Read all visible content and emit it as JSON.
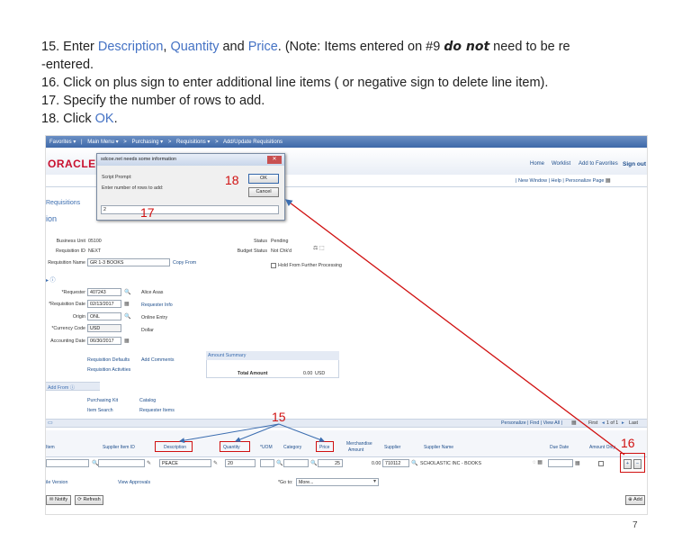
{
  "instructions": {
    "l15_a": "15.   Enter ",
    "l15_desc": "Description",
    "l15_b": ", ",
    "l15_qty": "Quantity",
    "l15_c": " and ",
    "l15_price": "Price",
    "l15_d": ". (Note:  Items entered  on #9 ",
    "l15_em": "do not",
    "l15_e": " need to be re",
    "l15_f": "-entered.",
    "l16": "16.   Click on plus sign to enter additional line items ( or negative sign to delete line item).",
    "l17": "17.  Specify the number of rows to add.",
    "l18_a": "18.   Click ",
    "l18_ok": "OK",
    "l18_b": "."
  },
  "nav": {
    "items": [
      "Favorites ▾",
      "|",
      "Main Menu ▾",
      ">",
      "Purchasing ▾",
      ">",
      "Requisitions ▾",
      ">",
      "Add/Update Requisitions"
    ]
  },
  "header": {
    "logo": "ORACLE",
    "home": "Home",
    "worklist": "Worklist",
    "add_fav": "Add to Favorites",
    "signout": "Sign out",
    "sublinks": "| New Window | Help | Personalize Page |"
  },
  "page": {
    "crumb": "Requisitions",
    "title": "ion"
  },
  "dialog": {
    "title": "sdcoe.net needs some information",
    "close": "✕",
    "prompt_a": "Script Prompt:",
    "prompt_b": "Enter number of rows to add:",
    "value": "2",
    "ok": "OK",
    "cancel": "Cancel"
  },
  "form": {
    "bu_label": "Business Unit",
    "bu_value": "05100",
    "reqid_label": "Requisition ID",
    "reqid_value": "NEXT",
    "reqname_label": "Requisition Name",
    "reqname_value": "GR 1-3 BOOKS",
    "copy_from": "Copy From",
    "status_label": "Status",
    "status_value": "Pending",
    "budget_label": "Budget Status",
    "budget_value": "Not Chk'd",
    "hold": "Hold From Further Processing",
    "requester_label": "*Requester",
    "requester_value": "407243",
    "requester_name": "Alice Asas",
    "reqdate_label": "*Requisition Date",
    "reqdate_value": "02/13/2017",
    "requester_info": "Requester Info",
    "origin_label": "Origin",
    "origin_value": "ONL",
    "origin_desc": "Online Entry",
    "currency_label": "*Currency Code",
    "currency_value": "USD",
    "currency_desc": "Dollar",
    "acctdate_label": "Accounting Date",
    "acctdate_value": "06/30/2017",
    "req_defaults": "Requisition Defaults",
    "add_comments": "Add Comments",
    "req_activities": "Requisition Activities",
    "amount_summary": "Amount Summary",
    "total_amount_label": "Total Amount",
    "total_amount_value": "0.00",
    "total_currency": "USD",
    "add_from": "Add From",
    "purchasing_kit": "Purchasing Kit",
    "catalog": "Catalog",
    "item_search": "Item Search",
    "requester_items": "Requester Items"
  },
  "grid": {
    "nav": "Personalize | Find | View All |",
    "paging": "First",
    "paging2": "1 of 1",
    "last": "Last",
    "headers": {
      "item": "Item",
      "supplier_item": "Supplier Item ID",
      "description": "Description",
      "quantity": "Quantity",
      "uom": "*UOM",
      "category": "Category",
      "price": "Price",
      "merch1": "Merchandise",
      "merch2": "Amount",
      "supplier": "Supplier",
      "supplier_name": "Supplier Name",
      "due_date": "Due Date",
      "amount_only": "Amount Only"
    },
    "row": {
      "description": "PEACE",
      "quantity": "20",
      "price": "25",
      "merch_amount": "0.00",
      "supplier": "710112",
      "supplier_name": "SCHOLASTIC INC - BOOKS"
    },
    "plus": "+",
    "minus": "−",
    "version": "ile Version",
    "view_approvals": "View Approvals",
    "goto_label": "*Go to:",
    "goto_value": "More...",
    "notify": "Notify",
    "refresh": "Refresh",
    "add": "Add"
  },
  "annotations": {
    "a15": "15",
    "a16": "16",
    "a17": "17",
    "a18": "18"
  },
  "page_number": "7",
  "colors": {
    "annotation": "#d01010",
    "link": "#1e4e8c",
    "nav": "#3e68a8",
    "brand": "#c8102e"
  }
}
